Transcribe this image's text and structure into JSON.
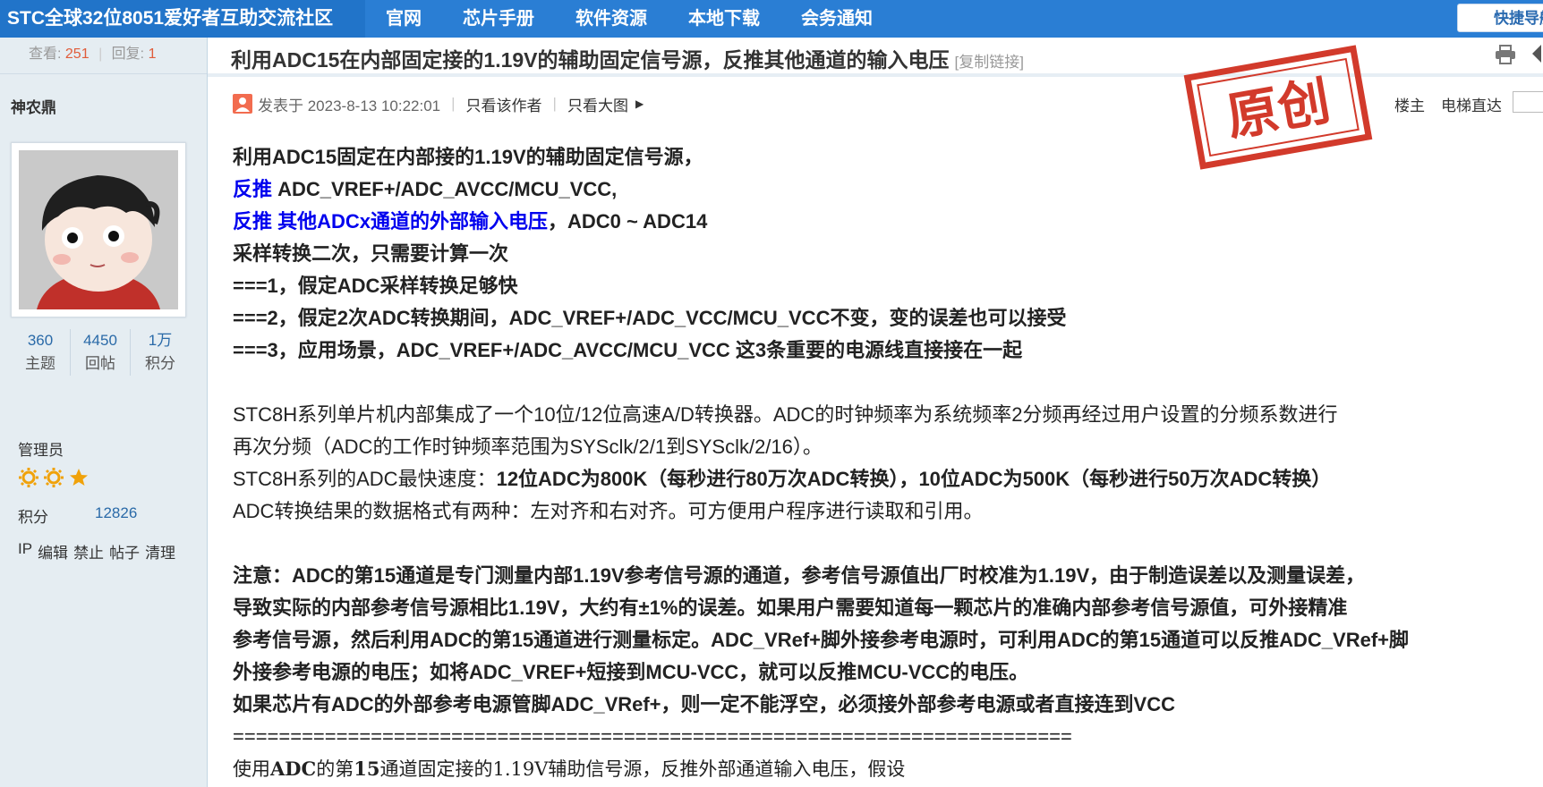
{
  "topbar": {
    "brand": "STC全球32位8051爱好者互助交流社区",
    "nav": [
      "官网",
      "芯片手册",
      "软件资源",
      "本地下载",
      "会务通知"
    ],
    "quick_nav": "快捷导航",
    "colors": {
      "bar": "#2a7ed4",
      "brand_bg": "#2174c9"
    }
  },
  "thread_stats": {
    "views_label": "查看:",
    "views": "251",
    "replies_label": "回复:",
    "replies": "1"
  },
  "title": {
    "text": "利用ADC15在内部固定接的1.19V的辅助固定信号源，反推其他通道的输入电压",
    "copy_link": "[复制链接]"
  },
  "author": {
    "name": "神农鼎",
    "counts": [
      {
        "value": "360",
        "label": "主题"
      },
      {
        "value": "4450",
        "label": "回帖"
      },
      {
        "value": "1万",
        "label": "积分"
      }
    ],
    "role": "管理员",
    "stars": [
      "sun-icon",
      "sun-icon",
      "star-icon"
    ],
    "score_label": "积分",
    "score": "12826",
    "admin_links": [
      "IP",
      "编辑",
      "禁止",
      "帖子",
      "清理"
    ]
  },
  "post_meta": {
    "icon": "user-icon",
    "posted": "发表于 2023-8-13 10:22:01",
    "only_author": "只看该作者",
    "big_image": "只看大图",
    "floor": "楼主",
    "elevator": "电梯直达",
    "stamp": "原创"
  },
  "content": {
    "l1": "利用ADC15固定在内部接的1.19V的辅助固定信号源，",
    "l2a": "反推",
    "l2b": " ADC_VREF+/ADC_AVCC/MCU_VCC,",
    "l3a": "反推 其他ADCx通道的外部输入电压",
    "l3b": "，ADC0 ~ ADC14",
    "l4": "采样转换二次，只需要计算一次",
    "l5": "===1，假定ADC采样转换足够快",
    "l6": "===2，假定2次ADC转换期间，ADC_VREF+/ADC_VCC/MCU_VCC不变，变的误差也可以接受",
    "l7": "===3，应用场景，ADC_VREF+/ADC_AVCC/MCU_VCC 这3条重要的电源线直接接在一起",
    "p1": "STC8H系列单片机内部集成了一个10位/12位高速A/D转换器。ADC的时钟频率为系统频率2分频再经过用户设置的分频系数进行",
    "p2": "再次分频（ADC的工作时钟频率范围为SYSclk/2/1到SYSclk/2/16）。",
    "p3a": "STC8H系列的ADC最快速度：",
    "p3b": "12位ADC为800K（每秒进行80万次ADC转换），10位ADC为500K（每秒进行50万次ADC转换）",
    "p4": "ADC转换结果的数据格式有两种：左对齐和右对齐。可方便用户程序进行读取和引用。",
    "n1": "注意：ADC的第15通道是专门测量内部1.19V参考信号源的通道，参考信号源值出厂时校准为1.19V，由于制造误差以及测量误差，",
    "n2": "导致实际的内部参考信号源相比1.19V，大约有±1%的误差。如果用户需要知道每一颗芯片的准确内部参考信号源值，可外接精准",
    "n3": "参考信号源，然后利用ADC的第15通道进行测量标定。ADC_VRef+脚外接参考电源时，可利用ADC的第15通道可以反推ADC_VRef+脚",
    "n4": "外接参考电源的电压；如将ADC_VREF+短接到MCU-VCC，就可以反推MCU-VCC的电压。",
    "n5": "如果芯片有ADC的外部参考电源管脚ADC_VRef+，则一定不能浮空，必须接外部参考电源或者直接连到VCC",
    "divider": "=========================================================================",
    "last_a": "使用",
    "last_b": "ADC",
    "last_c": "的第",
    "last_d": "15",
    "last_e": "通道固定接的1.19V辅助信号源，反推外部通道输入电压，假设"
  }
}
